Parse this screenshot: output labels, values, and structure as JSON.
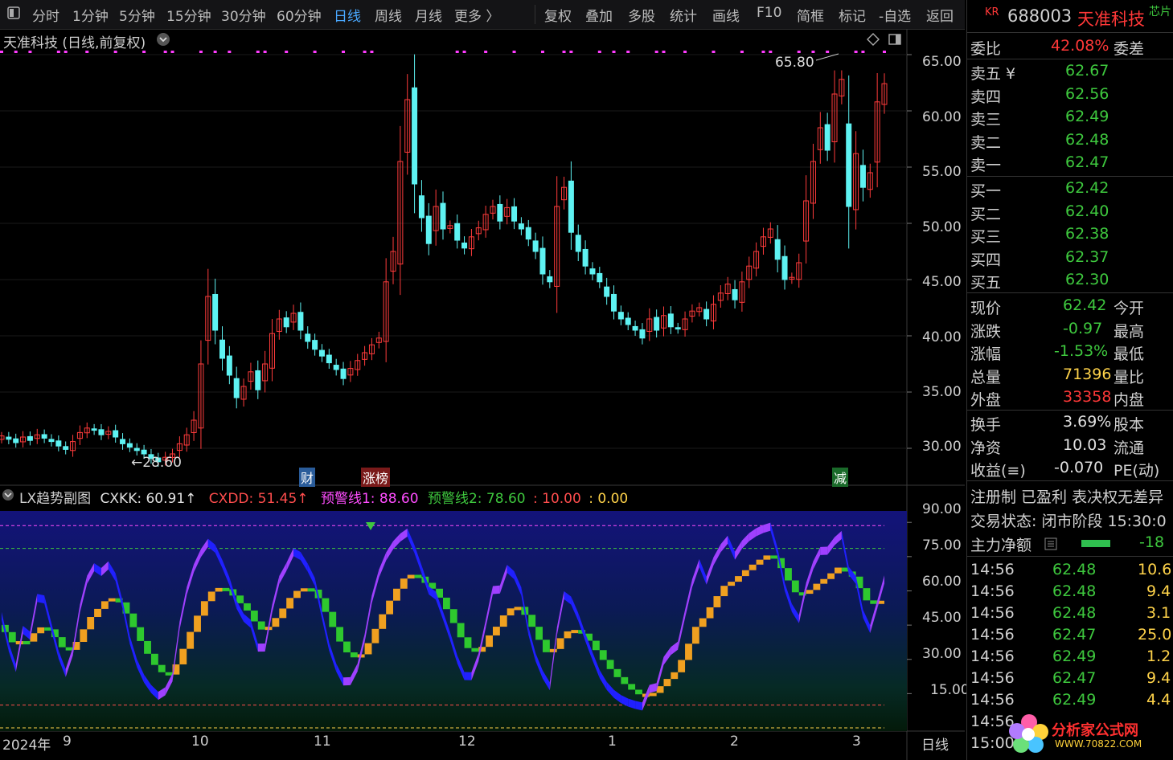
{
  "toolbar": {
    "left_icon": "panel-toggle-icon",
    "periods": [
      "分时",
      "1分钟",
      "5分钟",
      "15分钟",
      "30分钟",
      "60分钟",
      "日线",
      "周线",
      "月线",
      "更多 〉"
    ],
    "active_period": "日线",
    "actions": [
      "复权",
      "叠加",
      "多股",
      "统计",
      "画线",
      "F10",
      "简框",
      "标记",
      "-自选",
      "返回"
    ]
  },
  "price_panel": {
    "title": "天准科技 (日线,前复权)",
    "high_marker": "65.80",
    "low_marker": "←28.60",
    "axis_ticks": [
      "65.00",
      "60.00",
      "55.00",
      "50.00",
      "45.00",
      "40.00",
      "35.00",
      "30.00"
    ],
    "event_badges": [
      {
        "text": "财",
        "color": "#2a5c9a"
      },
      {
        "text": "涨榜",
        "color": "#7a1a1a"
      },
      {
        "text": "减",
        "color": "#1a6a2a"
      }
    ]
  },
  "indicator_panel": {
    "name": "LX趋势副图",
    "values": [
      {
        "text": "CXKK: 60.91↑",
        "color": "#e0e0e0"
      },
      {
        "text": "CXDD: 51.45↑",
        "color": "#ff4d4d"
      },
      {
        "text": "预警线1: 88.60",
        "color": "#ff4dff"
      },
      {
        "text": "预警线2: 78.60",
        "color": "#3ec83e"
      },
      {
        "text": ": 10.00",
        "color": "#ff4d4d"
      },
      {
        "text": ": 0.00",
        "color": "#ffd34a"
      }
    ],
    "axis_ticks": [
      "90.00",
      "75.00",
      "60.00",
      "45.00",
      "30.00",
      "15.00"
    ]
  },
  "time_axis": {
    "labels": [
      "2024年",
      "9",
      "10",
      "11",
      "12",
      "1",
      "2",
      "3"
    ],
    "mode": "日线"
  },
  "chart_data": {
    "type": "candlestick",
    "title": "天准科技 (日线,前复权)",
    "ylim": [
      27,
      67
    ],
    "annotations": {
      "max": 65.8,
      "min": 28.6
    },
    "x_months": [
      "2024年",
      "9",
      "10",
      "11",
      "12",
      "1",
      "2",
      "3"
    ],
    "closes": [
      31.1,
      30.8,
      30.5,
      31.0,
      30.7,
      31.2,
      30.9,
      30.6,
      30.2,
      29.9,
      30.6,
      31.4,
      31.8,
      31.6,
      31.2,
      31.5,
      31.0,
      30.4,
      30.1,
      29.8,
      29.5,
      29.1,
      28.8,
      29.2,
      29.5,
      30.4,
      31.2,
      32.5,
      37.5,
      43.5,
      40.5,
      38.0,
      36.5,
      34.5,
      35.5,
      36.8,
      35.2,
      37.5,
      40.2,
      41.5,
      40.8,
      42.0,
      40.5,
      39.5,
      38.8,
      38.2,
      37.6,
      37.0,
      36.2,
      37.1,
      37.8,
      38.5,
      39.2,
      39.8,
      44.8,
      47.5,
      55.5,
      61.0,
      53.5,
      50.5,
      48.2,
      51.5,
      49.5,
      49.8,
      48.5,
      47.8,
      48.8,
      49.6,
      50.8,
      51.5,
      50.2,
      51.4,
      50.2,
      49.5,
      48.6,
      47.5,
      45.5,
      44.8,
      51.5,
      53.2,
      49.2,
      47.5,
      46.2,
      45.5,
      44.8,
      43.5,
      42.2,
      41.5,
      41.0,
      40.5,
      39.8,
      41.5,
      40.5,
      41.8,
      40.8,
      40.6,
      41.5,
      42.2,
      42.5,
      41.5,
      42.8,
      43.8,
      44.6,
      43.2,
      44.8,
      46.2,
      47.5,
      48.8,
      49.5,
      46.8,
      45.0,
      45.2,
      46.5,
      52.0,
      55.5,
      58.5,
      56.5,
      61.5,
      62.8,
      51.5,
      56.2,
      53.2,
      54.5,
      60.8,
      62.42
    ],
    "indicator": {
      "series": [
        {
          "name": "CXKK",
          "last": 60.91
        },
        {
          "name": "CXDD",
          "last": 51.45
        }
      ],
      "reference_lines": [
        {
          "name": "预警线1",
          "value": 88.6
        },
        {
          "name": "预警线2",
          "value": 78.6
        },
        {
          "value": 10.0
        },
        {
          "value": 0.0
        }
      ],
      "ylim": [
        0,
        95
      ]
    }
  },
  "right_panel": {
    "header": {
      "badge": "KR",
      "code": "688003",
      "name": "天准科技",
      "extra": "芯片"
    },
    "weibi": {
      "label": "委比",
      "value": "42.08%",
      "suffix": "委差"
    },
    "asks": [
      {
        "label": "卖五 ¥",
        "price": "62.67"
      },
      {
        "label": "卖四",
        "price": "62.56"
      },
      {
        "label": "卖三",
        "price": "62.49"
      },
      {
        "label": "卖二",
        "price": "62.48"
      },
      {
        "label": "卖一",
        "price": "62.47"
      }
    ],
    "bids": [
      {
        "label": "买一",
        "price": "62.42"
      },
      {
        "label": "买二",
        "price": "62.40"
      },
      {
        "label": "买三",
        "price": "62.38"
      },
      {
        "label": "买四",
        "price": "62.37"
      },
      {
        "label": "买五",
        "price": "62.30"
      }
    ],
    "quote": [
      {
        "label": "现价",
        "value": "62.42",
        "vcolor": "green",
        "suffix": "今开"
      },
      {
        "label": "涨跌",
        "value": "-0.97",
        "vcolor": "green",
        "suffix": "最高"
      },
      {
        "label": "涨幅",
        "value": "-1.53%",
        "vcolor": "green",
        "suffix": "最低"
      },
      {
        "label": "总量",
        "value": "71396",
        "vcolor": "yellow",
        "suffix": "量比"
      },
      {
        "label": "外盘",
        "value": "33358",
        "vcolor": "red",
        "suffix": "内盘"
      }
    ],
    "fundamentals": [
      {
        "label": "换手",
        "value": "3.69%",
        "suffix": "股本"
      },
      {
        "label": "净资",
        "value": "10.03",
        "suffix": "流通"
      },
      {
        "label": "收益(≡)",
        "value": "-0.070",
        "suffix": "PE(动)"
      }
    ],
    "status": {
      "line1": "注册制  已盈利  表决权无差异",
      "line2": "交易状态: 闭市阶段 15:30:0",
      "net_label": "主力净额",
      "net_value": "-18",
      "net_bar_fraction": 0.6
    },
    "ticks": [
      {
        "time": "14:56",
        "price": "62.48",
        "vol": "10.6"
      },
      {
        "time": "14:56",
        "price": "62.48",
        "vol": "9.4"
      },
      {
        "time": "14:56",
        "price": "62.48",
        "vol": "3.1"
      },
      {
        "time": "14:56",
        "price": "62.47",
        "vol": "25.0"
      },
      {
        "time": "14:56",
        "price": "62.49",
        "vol": "1.2"
      },
      {
        "time": "14:56",
        "price": "62.47",
        "vol": "9.4"
      },
      {
        "time": "14:56",
        "price": "62.49",
        "vol": "4.4"
      },
      {
        "time": "14:56",
        "price": "",
        "vol": ""
      },
      {
        "time": "15:00",
        "price": "",
        "vol": ""
      }
    ]
  },
  "watermark": {
    "brand": "分析家公式网",
    "url": "WWW.70822.COM"
  }
}
